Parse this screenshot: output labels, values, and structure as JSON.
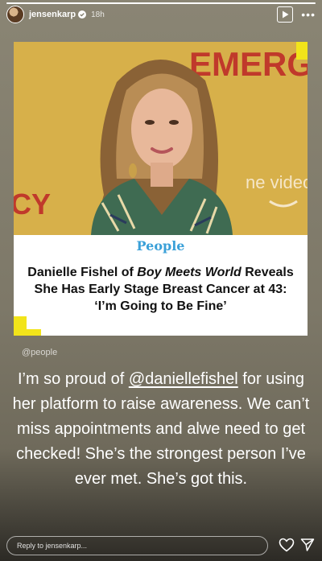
{
  "header": {
    "username": "jensenkarp",
    "time": "18h",
    "more": "•••"
  },
  "progress": 1.0,
  "card": {
    "brand": "People",
    "photo_background_text": [
      "EMERGEN",
      "ne video",
      "CY"
    ],
    "headline_pre": "Danielle Fishel of ",
    "headline_italic": "Boy Meets World",
    "headline_post": " Reveals She Has Early Stage Breast Cancer at 43: ‘I’m Going to Be Fine’"
  },
  "source": "@people",
  "caption": {
    "line_pre": "I’m so proud of ",
    "mention": "@daniellefishel",
    "line_post": " for using her platform to raise awareness. We can’t miss appointments and alwe need to get checked! She’s the strongest person I’ve ever met. She’s got this."
  },
  "reply": {
    "placeholder": "Reply to jensenkarp..."
  },
  "colors": {
    "accent_yellow": "#f2e41a",
    "brand_blue": "#3aa0d8",
    "photo_bg": "#d7b04a"
  }
}
